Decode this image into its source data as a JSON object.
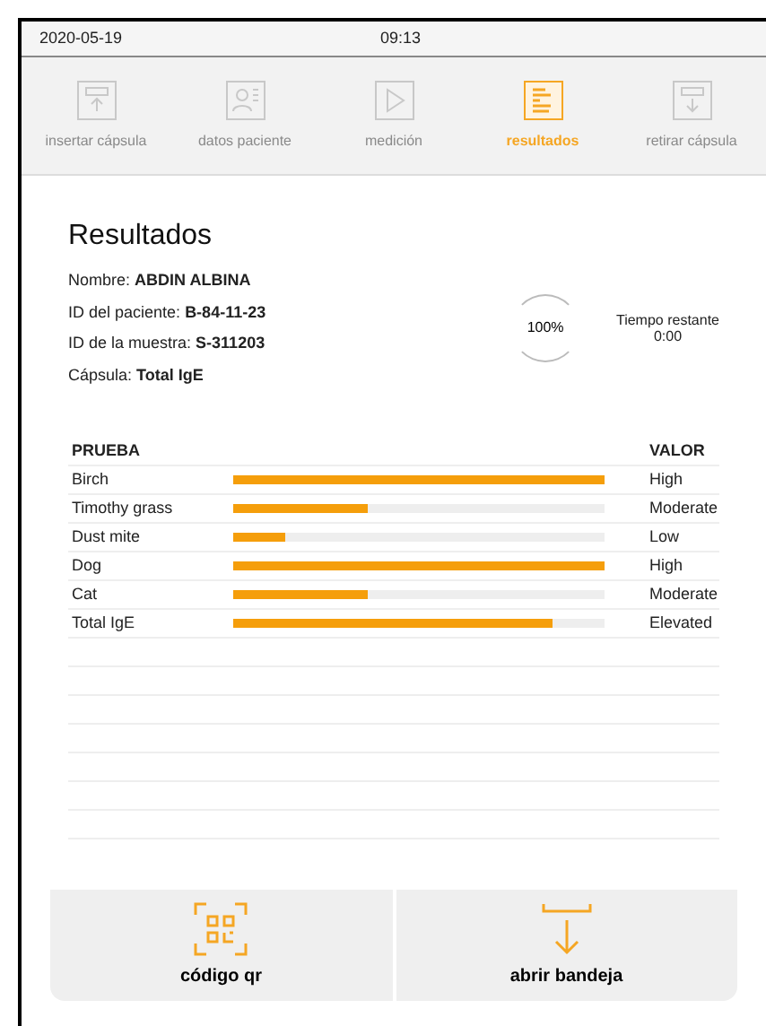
{
  "status_bar": {
    "date": "2020-05-19",
    "time": "09:13"
  },
  "steps": [
    {
      "label": "insertar cápsula",
      "selected": false,
      "kind": "insert"
    },
    {
      "label": "datos paciente",
      "selected": false,
      "kind": "patient"
    },
    {
      "label": "medición",
      "selected": false,
      "kind": "play"
    },
    {
      "label": "resultados",
      "selected": true,
      "kind": "results"
    },
    {
      "label": "retirar cápsula",
      "selected": false,
      "kind": "remove"
    }
  ],
  "title": "Resultados",
  "info": [
    {
      "label": "Nombre:",
      "value": "ABDIN ALBINA"
    },
    {
      "label": "ID del paciente:",
      "value": "B-84-11-23"
    },
    {
      "label": "ID de la muestra:",
      "value": "S-311203"
    },
    {
      "label": "Cápsula:",
      "value": "Total IgE"
    }
  ],
  "progress": "100%",
  "remaining": {
    "label": "Tiempo restante",
    "value": "0:00"
  },
  "table": {
    "columns": [
      "PRUEBA",
      "VALOR"
    ],
    "rows": [
      {
        "test": "Birch",
        "level": 1,
        "value": "High"
      },
      {
        "test": "Timothy grass",
        "level": 0.36,
        "value": "Moderate"
      },
      {
        "test": "Dust mite",
        "level": 0.14,
        "value": "Low"
      },
      {
        "test": "Dog",
        "level": 1,
        "value": "High"
      },
      {
        "test": "Cat",
        "level": 0.36,
        "value": "Moderate"
      },
      {
        "test": "Total IgE",
        "level": 0.86,
        "value": "Elevated"
      }
    ]
  },
  "buttons": [
    {
      "label": "código qr",
      "kind": "qr"
    },
    {
      "label": "abrir bandeja",
      "kind": "tray"
    }
  ]
}
